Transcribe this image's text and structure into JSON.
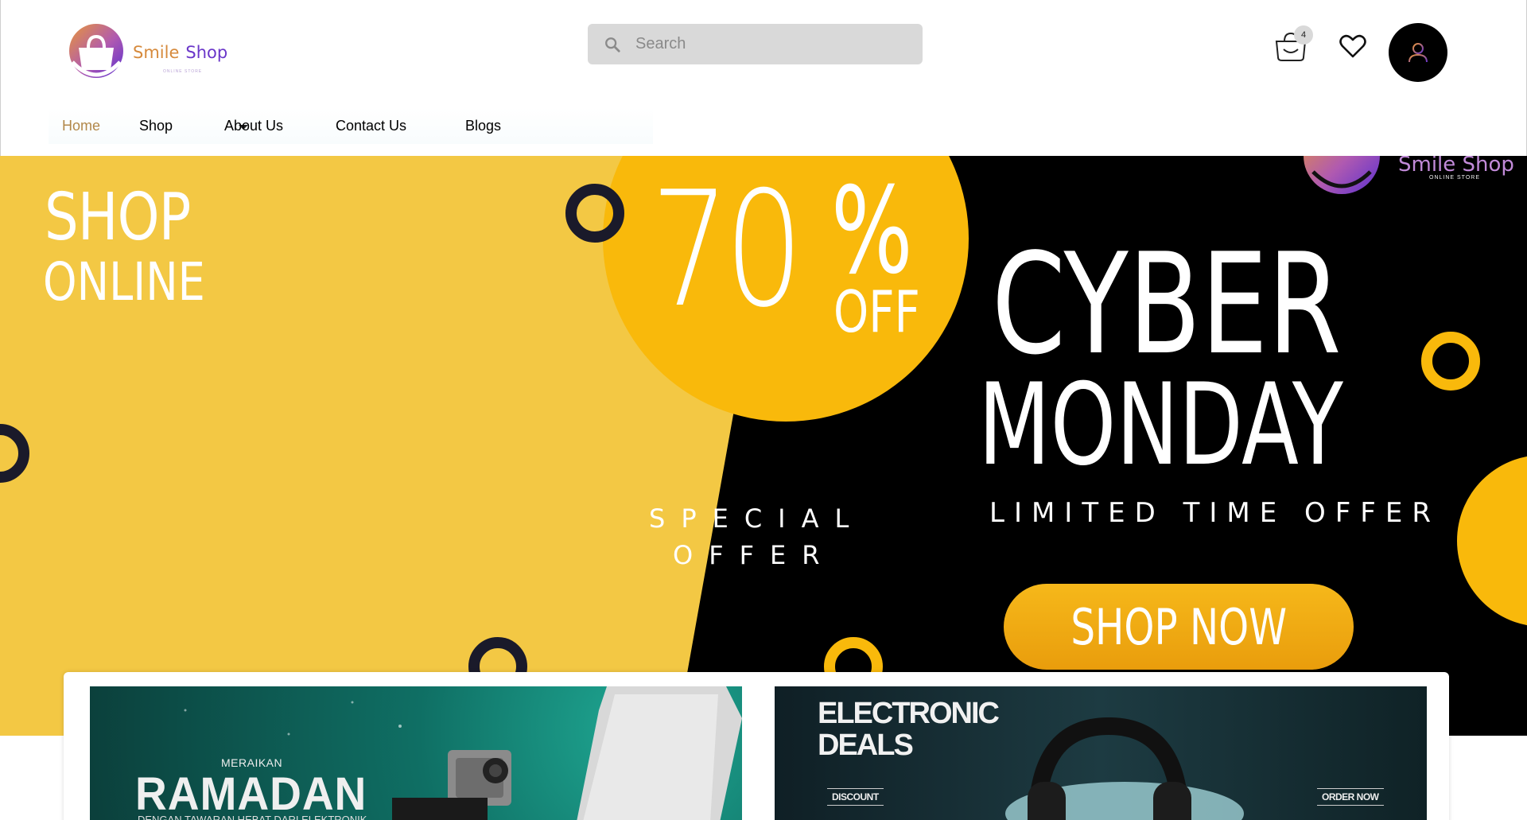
{
  "header": {
    "logo": {
      "word1": "Smile",
      "word2": "Shop",
      "tagline": "ONLINE STORE"
    },
    "search": {
      "placeholder": "Search"
    },
    "cart": {
      "count": "4"
    }
  },
  "nav": {
    "items": [
      {
        "label": "Home",
        "active": true
      },
      {
        "label": "Shop"
      },
      {
        "label": "About Us"
      },
      {
        "label": "Contact Us"
      },
      {
        "label": "Blogs"
      }
    ]
  },
  "hero": {
    "shop_line1": "SHOP",
    "shop_line2": "ONLINE",
    "discount_number": "70",
    "discount_percent": "%",
    "discount_off": "OFF",
    "title_line1": "CYBER",
    "title_line2": "MONDAY",
    "limited": "LIMITED TIME OFFER",
    "special_line1": "SPECIAL",
    "special_line2": "OFFER",
    "cta": "SHOP NOW",
    "logo_text": "Smile  Shop",
    "logo_tagline": "ONLINE STORE"
  },
  "promos": {
    "left": {
      "kicker": "MERAIKAN",
      "title": "RAMADAN",
      "subtitle": "DENGAN TAWARAN HEBAT DARI ELEKTRONIK"
    },
    "right": {
      "title_line1": "ELECTRONIC",
      "title_line2": "DEALS",
      "discount": "DISCOUNT",
      "order": "ORDER NOW"
    }
  },
  "colors": {
    "accent_yellow": "#f3c844",
    "circle_yellow": "#f9b90b",
    "hero_dark": "#000000",
    "brand_orange": "#d68a3c",
    "brand_purple": "#6a36c9",
    "nav_active": "#b2884a"
  },
  "icons": [
    "shopping-bag-logo-icon",
    "search-icon",
    "cart-icon",
    "heart-icon",
    "user-icon",
    "chevron-down-icon"
  ]
}
